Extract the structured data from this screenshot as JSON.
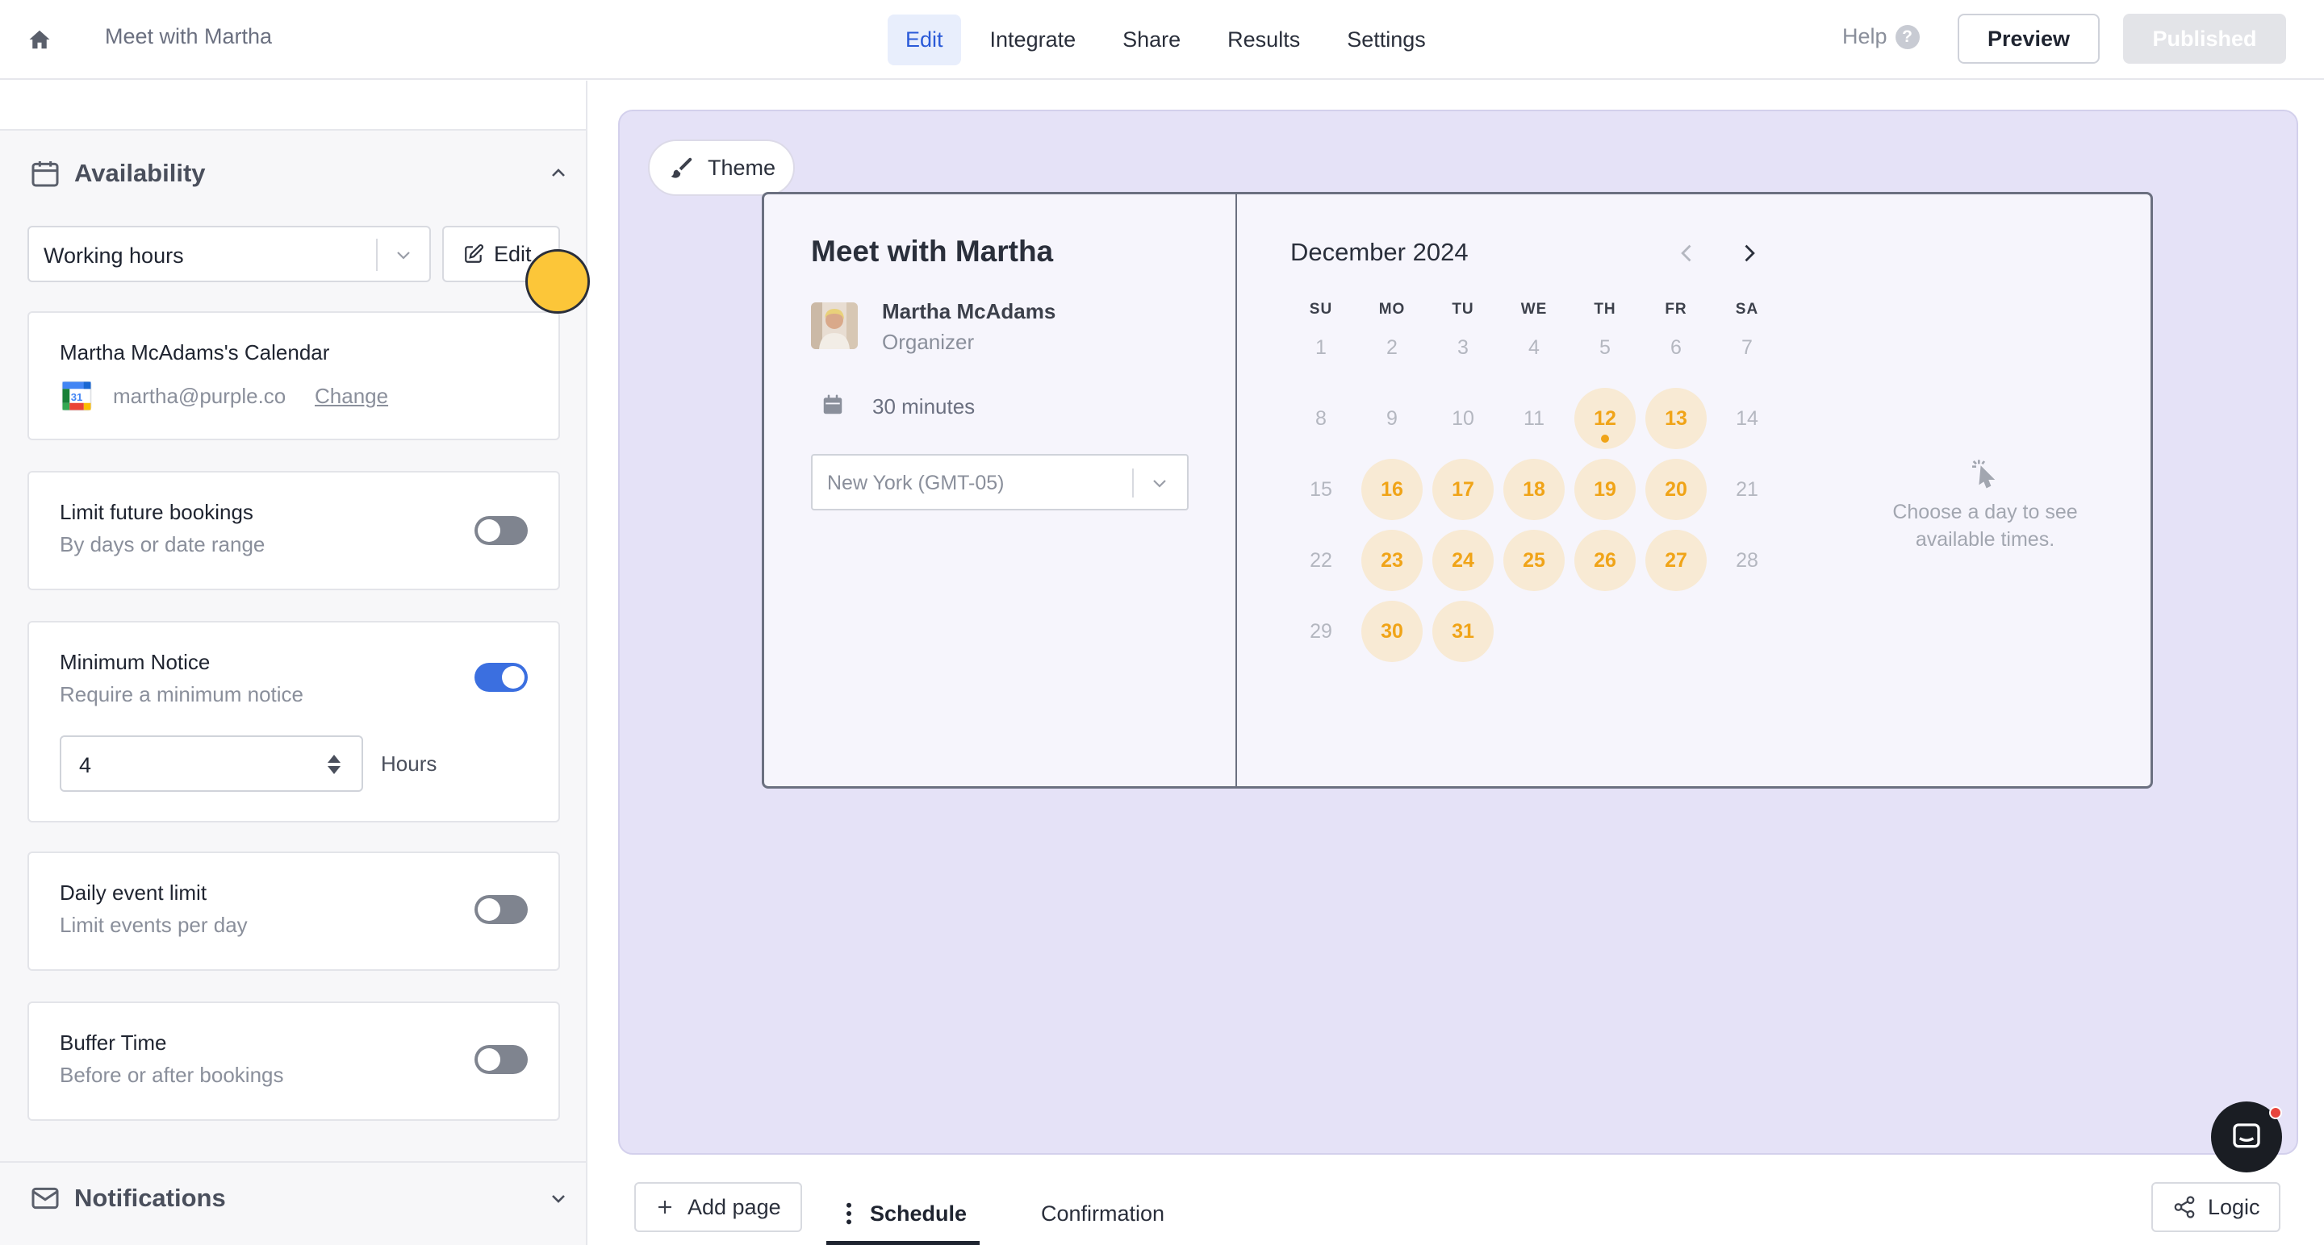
{
  "header": {
    "form_title": "Meet with Martha",
    "tabs": [
      {
        "label": "Edit",
        "active": true
      },
      {
        "label": "Integrate",
        "active": false
      },
      {
        "label": "Share",
        "active": false
      },
      {
        "label": "Results",
        "active": false
      },
      {
        "label": "Settings",
        "active": false
      }
    ],
    "help_label": "Help",
    "preview_label": "Preview",
    "published_label": "Published"
  },
  "sidebar": {
    "availability": {
      "title": "Availability",
      "schedule_select": "Working hours",
      "edit_label": "Edit"
    },
    "calendar": {
      "title": "Martha McAdams's Calendar",
      "email": "martha@purple.co",
      "change_label": "Change"
    },
    "limit_future": {
      "title": "Limit future bookings",
      "subtitle": "By days or date range",
      "enabled": false
    },
    "minimum_notice": {
      "title": "Minimum Notice",
      "subtitle": "Require a minimum notice",
      "enabled": true,
      "value": "4",
      "unit": "Hours"
    },
    "daily_limit": {
      "title": "Daily event limit",
      "subtitle": "Limit events per day",
      "enabled": false
    },
    "buffer_time": {
      "title": "Buffer Time",
      "subtitle": "Before or after bookings",
      "enabled": false
    },
    "notifications": {
      "title": "Notifications"
    }
  },
  "canvas": {
    "theme_label": "Theme",
    "event": {
      "title": "Meet with Martha",
      "organizer_name": "Martha McAdams",
      "organizer_role": "Organizer",
      "duration": "30 minutes",
      "timezone": "New York (GMT-05)"
    },
    "calendar": {
      "month_label": "December 2024",
      "weekdays": [
        "SU",
        "MO",
        "TU",
        "WE",
        "TH",
        "FR",
        "SA"
      ],
      "weeks": [
        [
          "1",
          "2",
          "3",
          "4",
          "5",
          "6",
          "7"
        ],
        [
          "8",
          "9",
          "10",
          "11",
          "12",
          "13",
          "14"
        ],
        [
          "15",
          "16",
          "17",
          "18",
          "19",
          "20",
          "21"
        ],
        [
          "22",
          "23",
          "24",
          "25",
          "26",
          "27",
          "28"
        ],
        [
          "29",
          "30",
          "31"
        ]
      ],
      "available_days": [
        "12",
        "13",
        "16",
        "17",
        "18",
        "19",
        "20",
        "23",
        "24",
        "25",
        "26",
        "27",
        "30",
        "31"
      ],
      "today": "12",
      "empty_state": "Choose a day to see available times."
    }
  },
  "footer": {
    "add_page_label": "Add page",
    "pages": [
      {
        "label": "Schedule",
        "active": true
      },
      {
        "label": "Confirmation",
        "active": false
      }
    ],
    "logic_label": "Logic"
  },
  "colors": {
    "accent_blue": "#3b6fe0",
    "available_day_bg": "#f8ead4",
    "available_day_text": "#f0a418",
    "canvas_bg": "#e5e2f7"
  }
}
